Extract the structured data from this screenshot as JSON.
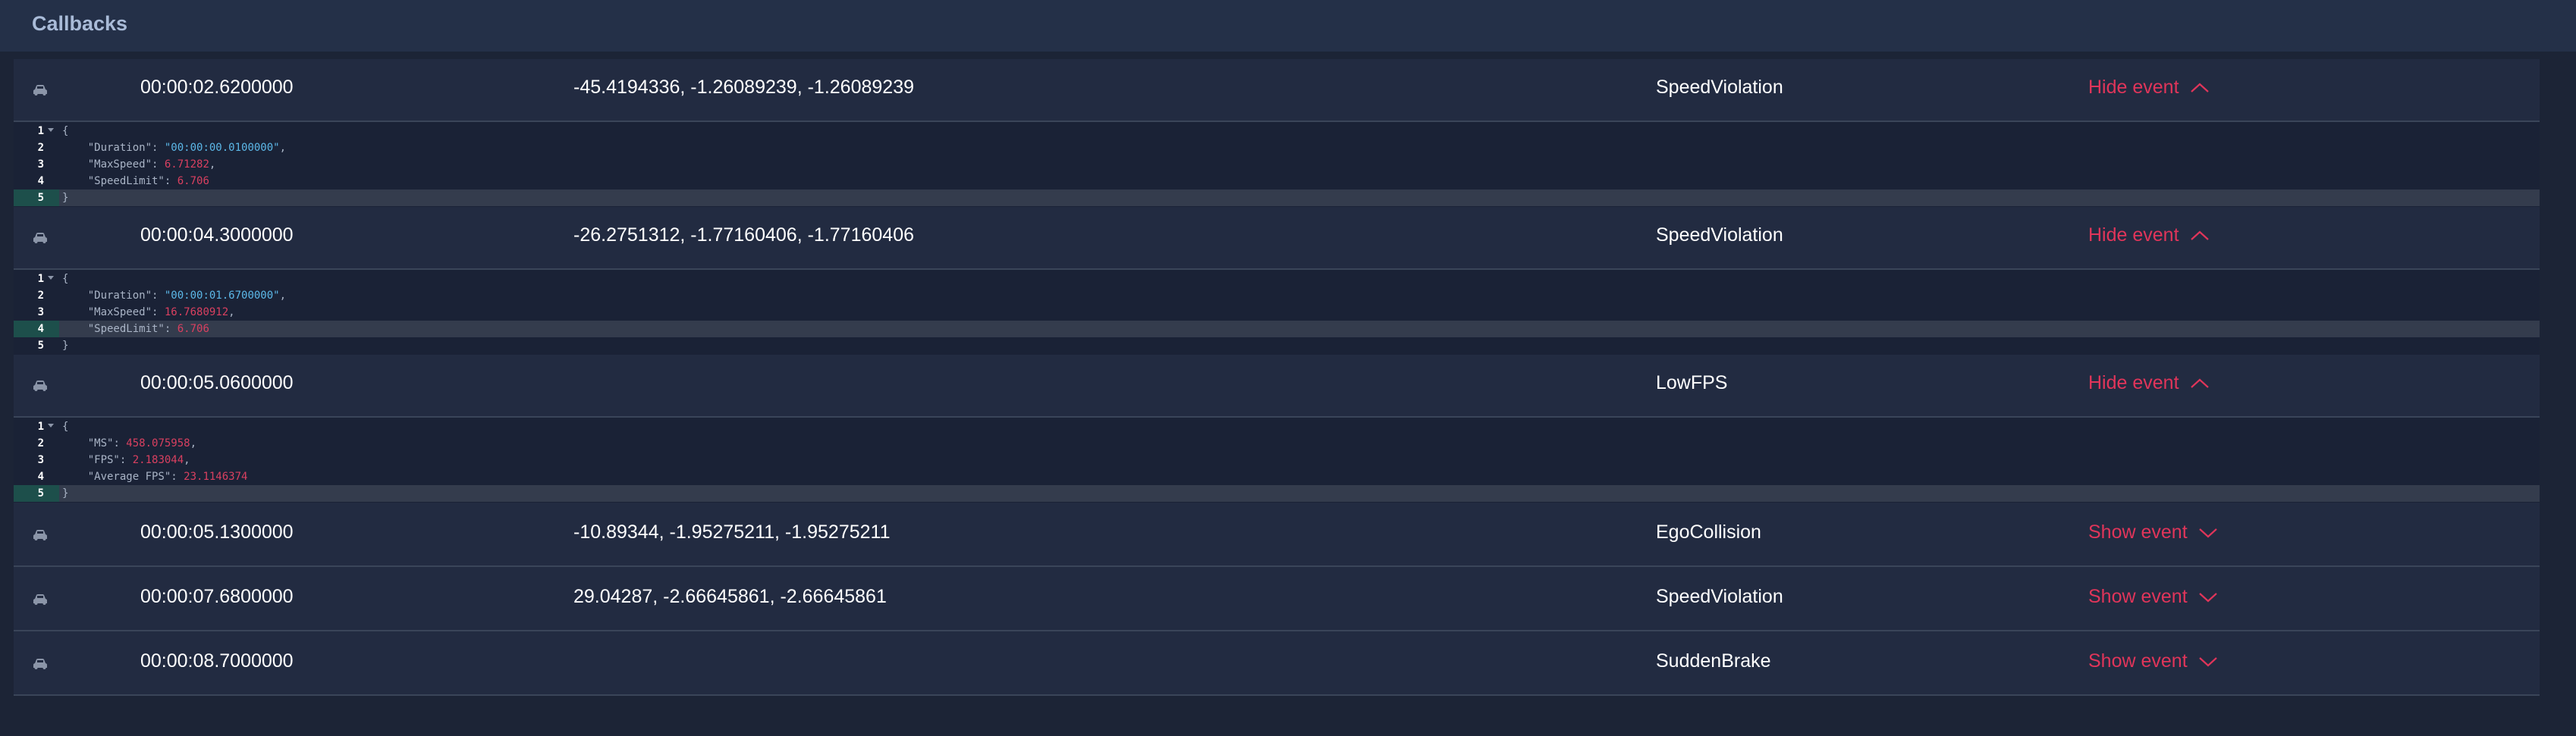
{
  "panel": {
    "title": "Callbacks"
  },
  "colors": {
    "accent": "#e0355a",
    "string": "#5cb8e8",
    "number": "#d94060",
    "background": "#1c2436"
  },
  "events": [
    {
      "icon": "car-icon",
      "time": "00:00:02.6200000",
      "position": "-45.4194336, -1.26089239, -1.26089239",
      "type": "SpeedViolation",
      "toggle_label": "Hide event",
      "expanded": true,
      "json_lines": [
        {
          "num": "1",
          "text": "{"
        },
        {
          "num": "2",
          "key": "\"Duration\"",
          "value": "\"00:00:00.0100000\"",
          "value_kind": "str",
          "trail": ","
        },
        {
          "num": "3",
          "key": "\"MaxSpeed\"",
          "value": "6.71282",
          "value_kind": "num",
          "trail": ","
        },
        {
          "num": "4",
          "key": "\"SpeedLimit\"",
          "value": "6.706",
          "value_kind": "num",
          "trail": ""
        },
        {
          "num": "5",
          "text": "}"
        }
      ]
    },
    {
      "icon": "car-icon",
      "time": "00:00:04.3000000",
      "position": "-26.2751312, -1.77160406, -1.77160406",
      "type": "SpeedViolation",
      "toggle_label": "Hide event",
      "expanded": true,
      "json_lines": [
        {
          "num": "1",
          "text": "{"
        },
        {
          "num": "2",
          "key": "\"Duration\"",
          "value": "\"00:00:01.6700000\"",
          "value_kind": "str",
          "trail": ","
        },
        {
          "num": "3",
          "key": "\"MaxSpeed\"",
          "value": "16.7680912",
          "value_kind": "num",
          "trail": ","
        },
        {
          "num": "4",
          "key": "\"SpeedLimit\"",
          "value": "6.706",
          "value_kind": "num",
          "trail": ""
        },
        {
          "num": "5",
          "text": "}"
        }
      ]
    },
    {
      "icon": "car-icon",
      "time": "00:00:05.0600000",
      "position": "",
      "type": "LowFPS",
      "toggle_label": "Hide event",
      "expanded": true,
      "json_lines": [
        {
          "num": "1",
          "text": "{"
        },
        {
          "num": "2",
          "key": "\"MS\"",
          "value": "458.075958",
          "value_kind": "num",
          "trail": ","
        },
        {
          "num": "3",
          "key": "\"FPS\"",
          "value": "2.183044",
          "value_kind": "num",
          "trail": ","
        },
        {
          "num": "4",
          "key": "\"Average FPS\"",
          "value": "23.1146374",
          "value_kind": "num",
          "trail": ""
        },
        {
          "num": "5",
          "text": "}"
        }
      ]
    },
    {
      "icon": "car-icon",
      "time": "00:00:05.1300000",
      "position": "-10.89344, -1.95275211, -1.95275211",
      "type": "EgoCollision",
      "toggle_label": "Show event",
      "expanded": false
    },
    {
      "icon": "car-icon",
      "time": "00:00:07.6800000",
      "position": "29.04287, -2.66645861, -2.66645861",
      "type": "SpeedViolation",
      "toggle_label": "Show event",
      "expanded": false
    },
    {
      "icon": "car-icon",
      "time": "00:00:08.7000000",
      "position": "",
      "type": "SuddenBrake",
      "toggle_label": "Show event",
      "expanded": false
    }
  ]
}
